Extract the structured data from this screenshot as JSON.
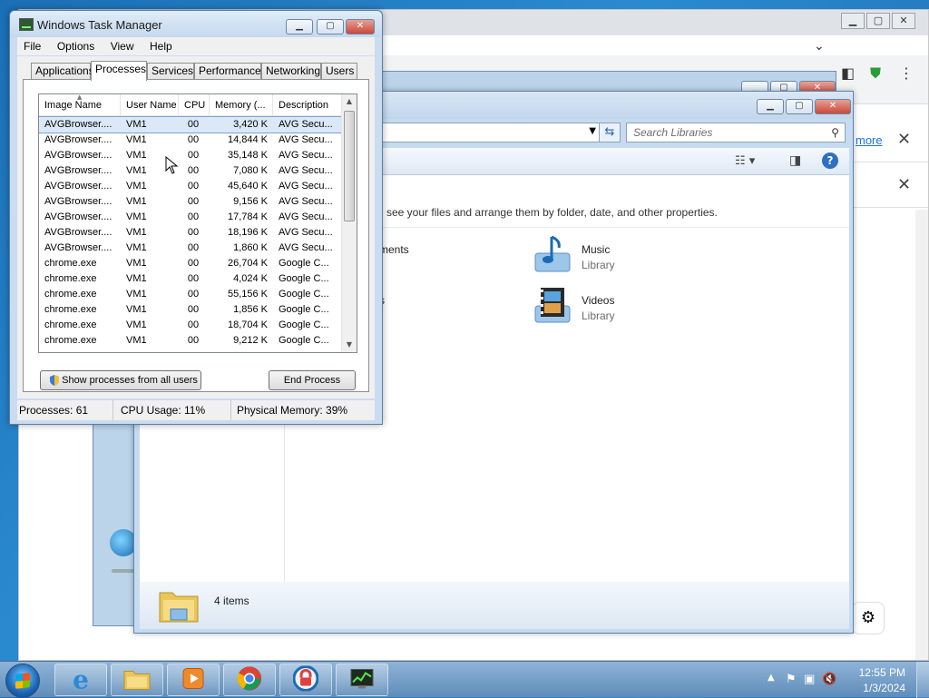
{
  "chrome": {
    "more_link": "more",
    "close_glyph": "✕",
    "menu_glyph": "⋮",
    "filter_glyph": "⚙"
  },
  "explorer": {
    "search_placeholder": "Search Libraries",
    "description": "see your files and arrange them by folder, date, and other properties.",
    "items": [
      {
        "name": "ments",
        "sub": ""
      },
      {
        "name": "Music",
        "sub": "Library"
      },
      {
        "name": "s",
        "sub": ""
      },
      {
        "name": "Videos",
        "sub": "Library"
      }
    ],
    "status_count": "4 items"
  },
  "task_manager": {
    "title": "Windows Task Manager",
    "menus": [
      "File",
      "Options",
      "View",
      "Help"
    ],
    "tabs": [
      "Applications",
      "Processes",
      "Services",
      "Performance",
      "Networking",
      "Users"
    ],
    "active_tab": "Processes",
    "columns": [
      "Image Name",
      "User Name",
      "CPU",
      "Memory (...",
      "Description"
    ],
    "rows": [
      {
        "name": "AVGBrowser....",
        "user": "VM1",
        "cpu": "00",
        "mem": "3,420 K",
        "desc": "AVG Secu..."
      },
      {
        "name": "AVGBrowser....",
        "user": "VM1",
        "cpu": "00",
        "mem": "14,844 K",
        "desc": "AVG Secu..."
      },
      {
        "name": "AVGBrowser....",
        "user": "VM1",
        "cpu": "00",
        "mem": "35,148 K",
        "desc": "AVG Secu..."
      },
      {
        "name": "AVGBrowser....",
        "user": "VM1",
        "cpu": "00",
        "mem": "7,080 K",
        "desc": "AVG Secu..."
      },
      {
        "name": "AVGBrowser....",
        "user": "VM1",
        "cpu": "00",
        "mem": "45,640 K",
        "desc": "AVG Secu..."
      },
      {
        "name": "AVGBrowser....",
        "user": "VM1",
        "cpu": "00",
        "mem": "9,156 K",
        "desc": "AVG Secu..."
      },
      {
        "name": "AVGBrowser....",
        "user": "VM1",
        "cpu": "00",
        "mem": "17,784 K",
        "desc": "AVG Secu..."
      },
      {
        "name": "AVGBrowser....",
        "user": "VM1",
        "cpu": "00",
        "mem": "18,196 K",
        "desc": "AVG Secu..."
      },
      {
        "name": "AVGBrowser....",
        "user": "VM1",
        "cpu": "00",
        "mem": "1,860 K",
        "desc": "AVG Secu..."
      },
      {
        "name": "chrome.exe",
        "user": "VM1",
        "cpu": "00",
        "mem": "26,704 K",
        "desc": "Google C..."
      },
      {
        "name": "chrome.exe",
        "user": "VM1",
        "cpu": "00",
        "mem": "4,024 K",
        "desc": "Google C..."
      },
      {
        "name": "chrome.exe",
        "user": "VM1",
        "cpu": "00",
        "mem": "55,156 K",
        "desc": "Google C..."
      },
      {
        "name": "chrome.exe",
        "user": "VM1",
        "cpu": "00",
        "mem": "1,856 K",
        "desc": "Google C..."
      },
      {
        "name": "chrome.exe",
        "user": "VM1",
        "cpu": "00",
        "mem": "18,704 K",
        "desc": "Google C..."
      },
      {
        "name": "chrome.exe",
        "user": "VM1",
        "cpu": "00",
        "mem": "9,212 K",
        "desc": "Google C..."
      }
    ],
    "show_all_label": "Show processes from all users",
    "end_process_label": "End Process",
    "status": {
      "processes": "Processes: 61",
      "cpu": "CPU Usage: 11%",
      "memory": "Physical Memory: 39%"
    }
  },
  "taskbar": {
    "time": "12:55 PM",
    "date": "1/3/2024",
    "items": [
      "internet-explorer-icon",
      "file-explorer-icon",
      "media-player-icon",
      "chrome-icon",
      "avg-browser-icon",
      "task-manager-icon"
    ]
  },
  "colors": {
    "accent_blue": "#1a73e8",
    "selection": "#dbe8f7",
    "taskbar": "#5f8cb9"
  }
}
